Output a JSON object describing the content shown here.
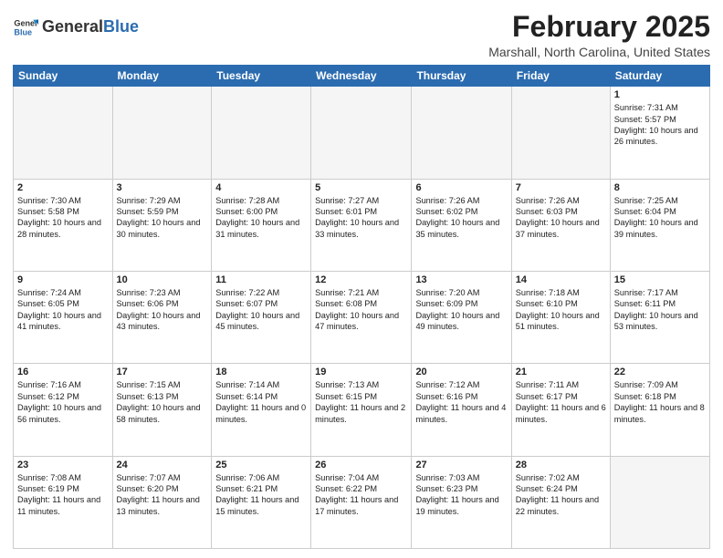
{
  "header": {
    "logo_general": "General",
    "logo_blue": "Blue",
    "title": "February 2025",
    "subtitle": "Marshall, North Carolina, United States"
  },
  "weekdays": [
    "Sunday",
    "Monday",
    "Tuesday",
    "Wednesday",
    "Thursday",
    "Friday",
    "Saturday"
  ],
  "weeks": [
    [
      {
        "day": "",
        "empty": true
      },
      {
        "day": "",
        "empty": true
      },
      {
        "day": "",
        "empty": true
      },
      {
        "day": "",
        "empty": true
      },
      {
        "day": "",
        "empty": true
      },
      {
        "day": "",
        "empty": true
      },
      {
        "day": "1",
        "sunrise": "7:31 AM",
        "sunset": "5:57 PM",
        "daylight": "10 hours and 26 minutes."
      }
    ],
    [
      {
        "day": "2",
        "sunrise": "7:30 AM",
        "sunset": "5:58 PM",
        "daylight": "10 hours and 28 minutes."
      },
      {
        "day": "3",
        "sunrise": "7:29 AM",
        "sunset": "5:59 PM",
        "daylight": "10 hours and 30 minutes."
      },
      {
        "day": "4",
        "sunrise": "7:28 AM",
        "sunset": "6:00 PM",
        "daylight": "10 hours and 31 minutes."
      },
      {
        "day": "5",
        "sunrise": "7:27 AM",
        "sunset": "6:01 PM",
        "daylight": "10 hours and 33 minutes."
      },
      {
        "day": "6",
        "sunrise": "7:26 AM",
        "sunset": "6:02 PM",
        "daylight": "10 hours and 35 minutes."
      },
      {
        "day": "7",
        "sunrise": "7:26 AM",
        "sunset": "6:03 PM",
        "daylight": "10 hours and 37 minutes."
      },
      {
        "day": "8",
        "sunrise": "7:25 AM",
        "sunset": "6:04 PM",
        "daylight": "10 hours and 39 minutes."
      }
    ],
    [
      {
        "day": "9",
        "sunrise": "7:24 AM",
        "sunset": "6:05 PM",
        "daylight": "10 hours and 41 minutes."
      },
      {
        "day": "10",
        "sunrise": "7:23 AM",
        "sunset": "6:06 PM",
        "daylight": "10 hours and 43 minutes."
      },
      {
        "day": "11",
        "sunrise": "7:22 AM",
        "sunset": "6:07 PM",
        "daylight": "10 hours and 45 minutes."
      },
      {
        "day": "12",
        "sunrise": "7:21 AM",
        "sunset": "6:08 PM",
        "daylight": "10 hours and 47 minutes."
      },
      {
        "day": "13",
        "sunrise": "7:20 AM",
        "sunset": "6:09 PM",
        "daylight": "10 hours and 49 minutes."
      },
      {
        "day": "14",
        "sunrise": "7:18 AM",
        "sunset": "6:10 PM",
        "daylight": "10 hours and 51 minutes."
      },
      {
        "day": "15",
        "sunrise": "7:17 AM",
        "sunset": "6:11 PM",
        "daylight": "10 hours and 53 minutes."
      }
    ],
    [
      {
        "day": "16",
        "sunrise": "7:16 AM",
        "sunset": "6:12 PM",
        "daylight": "10 hours and 56 minutes."
      },
      {
        "day": "17",
        "sunrise": "7:15 AM",
        "sunset": "6:13 PM",
        "daylight": "10 hours and 58 minutes."
      },
      {
        "day": "18",
        "sunrise": "7:14 AM",
        "sunset": "6:14 PM",
        "daylight": "11 hours and 0 minutes."
      },
      {
        "day": "19",
        "sunrise": "7:13 AM",
        "sunset": "6:15 PM",
        "daylight": "11 hours and 2 minutes."
      },
      {
        "day": "20",
        "sunrise": "7:12 AM",
        "sunset": "6:16 PM",
        "daylight": "11 hours and 4 minutes."
      },
      {
        "day": "21",
        "sunrise": "7:11 AM",
        "sunset": "6:17 PM",
        "daylight": "11 hours and 6 minutes."
      },
      {
        "day": "22",
        "sunrise": "7:09 AM",
        "sunset": "6:18 PM",
        "daylight": "11 hours and 8 minutes."
      }
    ],
    [
      {
        "day": "23",
        "sunrise": "7:08 AM",
        "sunset": "6:19 PM",
        "daylight": "11 hours and 11 minutes."
      },
      {
        "day": "24",
        "sunrise": "7:07 AM",
        "sunset": "6:20 PM",
        "daylight": "11 hours and 13 minutes."
      },
      {
        "day": "25",
        "sunrise": "7:06 AM",
        "sunset": "6:21 PM",
        "daylight": "11 hours and 15 minutes."
      },
      {
        "day": "26",
        "sunrise": "7:04 AM",
        "sunset": "6:22 PM",
        "daylight": "11 hours and 17 minutes."
      },
      {
        "day": "27",
        "sunrise": "7:03 AM",
        "sunset": "6:23 PM",
        "daylight": "11 hours and 19 minutes."
      },
      {
        "day": "28",
        "sunrise": "7:02 AM",
        "sunset": "6:24 PM",
        "daylight": "11 hours and 22 minutes."
      },
      {
        "day": "",
        "empty": true
      }
    ]
  ]
}
